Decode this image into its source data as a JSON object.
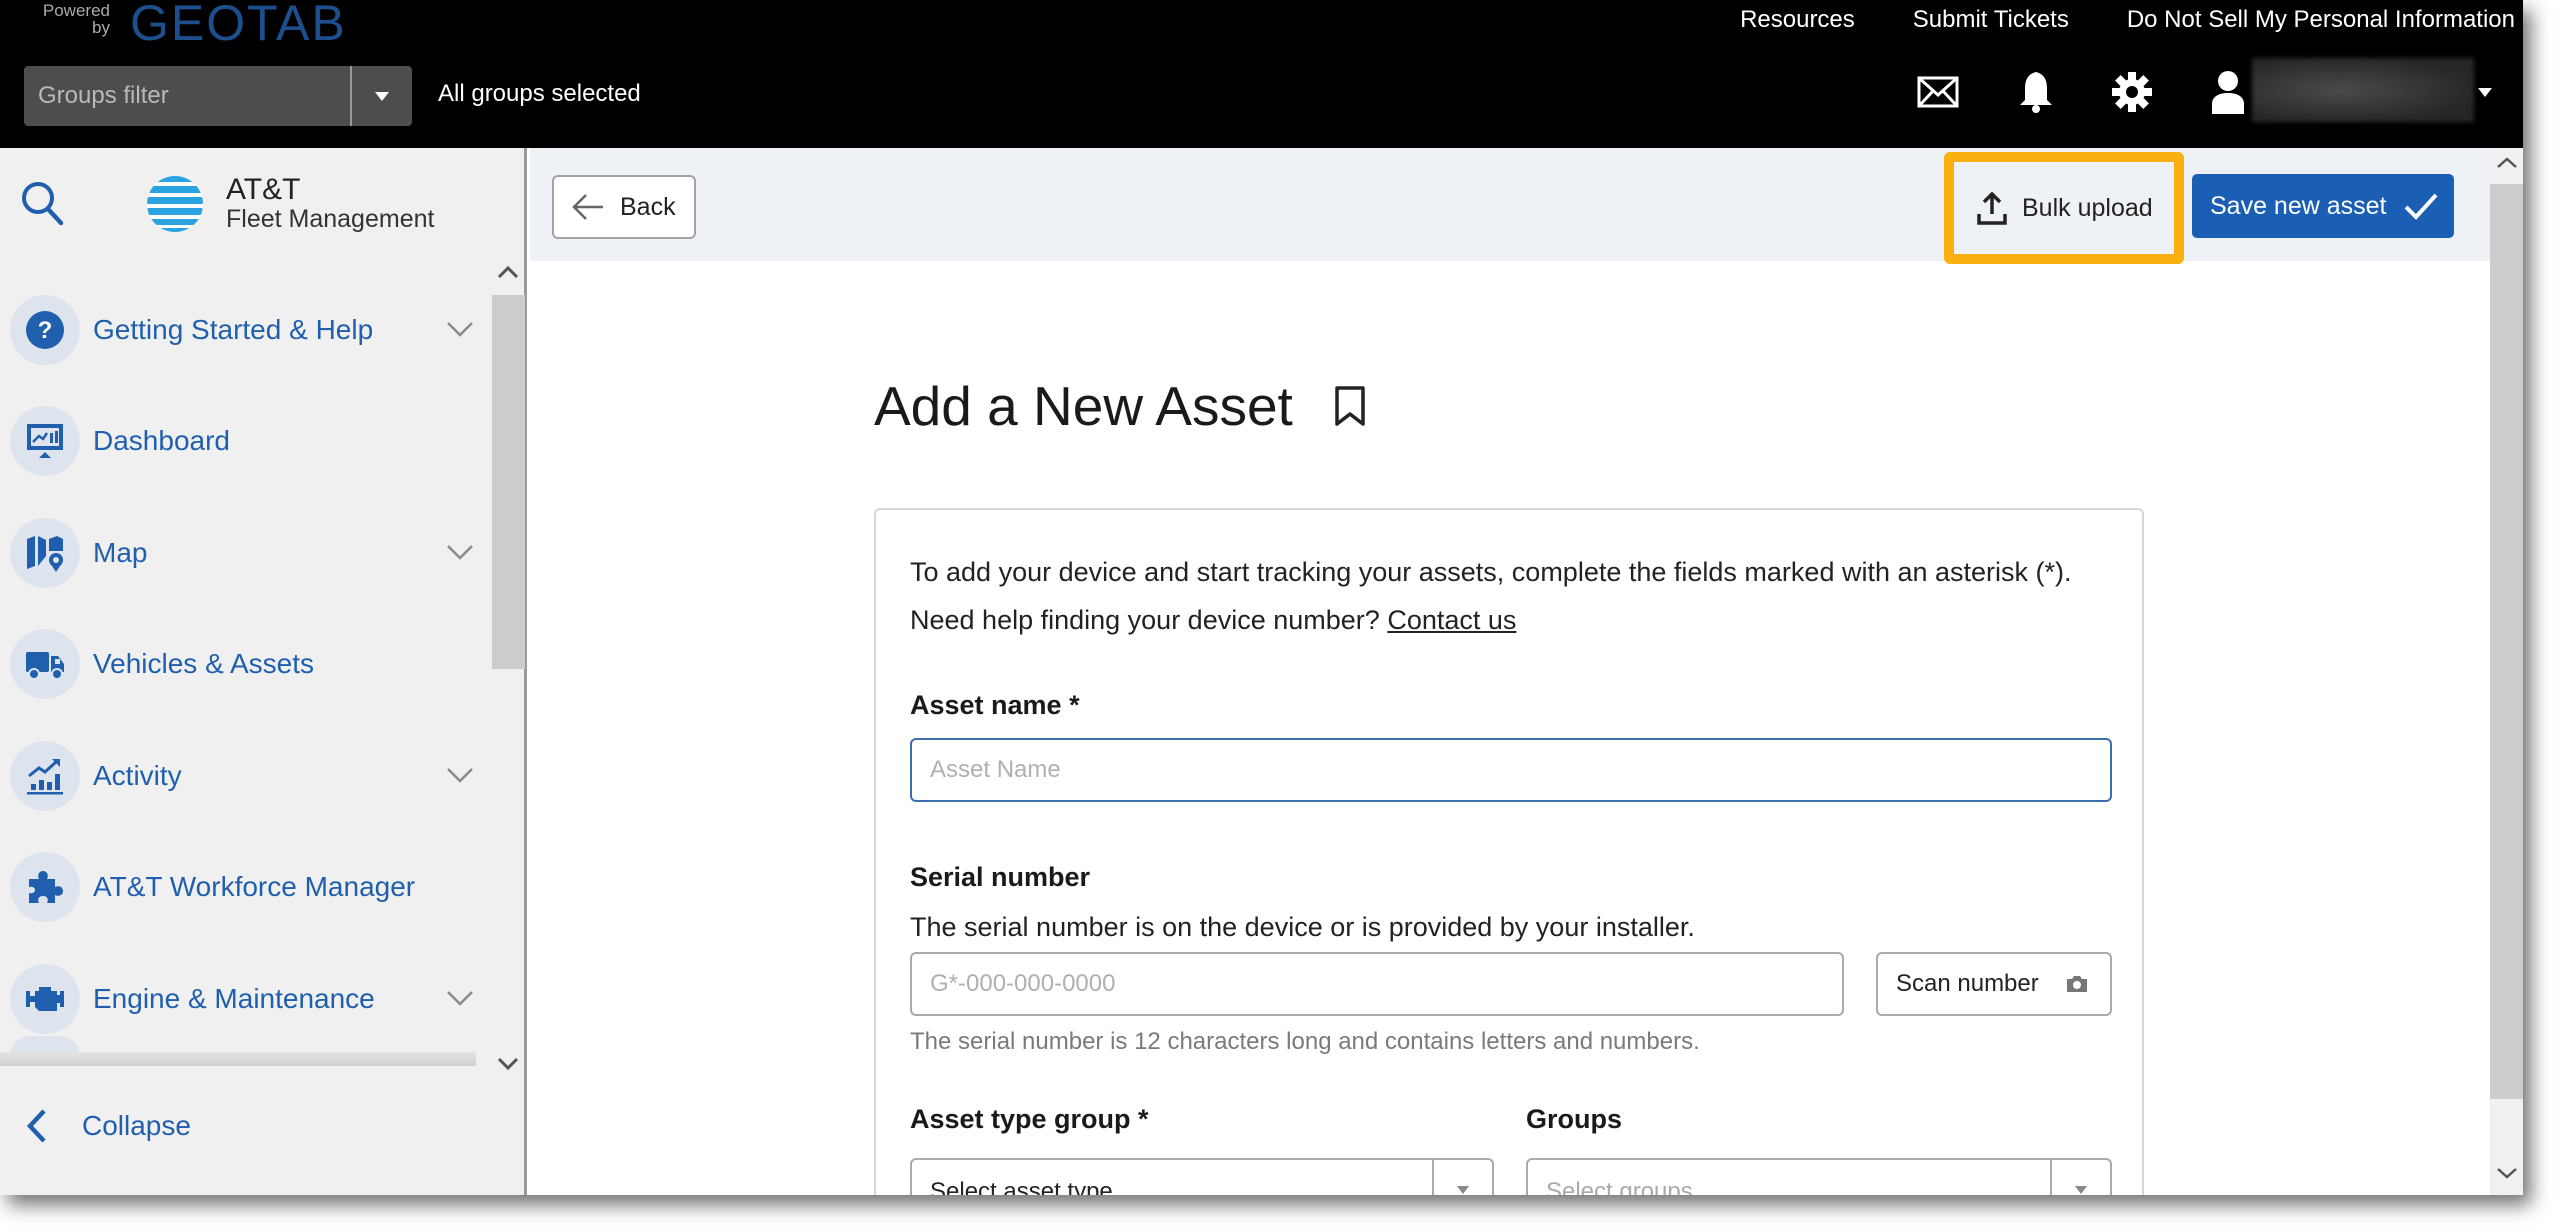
{
  "header": {
    "powered_by": "Powered by",
    "brand": "GEOTAB",
    "links": [
      "Resources",
      "Submit Tickets",
      "Do Not Sell My Personal Information"
    ],
    "groups_filter": {
      "placeholder": "Groups filter",
      "status": "All groups selected"
    },
    "icons": [
      "mail-icon",
      "bell-icon",
      "gear-icon",
      "user-icon"
    ]
  },
  "sidebar": {
    "logo": {
      "line1": "AT&T",
      "line2": "Fleet Management"
    },
    "items": [
      {
        "label": "Getting Started & Help",
        "icon": "help-icon",
        "expandable": true
      },
      {
        "label": "Dashboard",
        "icon": "dashboard-icon",
        "expandable": false
      },
      {
        "label": "Map",
        "icon": "map-icon",
        "expandable": true
      },
      {
        "label": "Vehicles & Assets",
        "icon": "truck-icon",
        "expandable": false
      },
      {
        "label": "Activity",
        "icon": "activity-icon",
        "expandable": true
      },
      {
        "label": "AT&T Workforce Manager",
        "icon": "puzzle-icon",
        "expandable": false
      },
      {
        "label": "Engine & Maintenance",
        "icon": "engine-icon",
        "expandable": true
      }
    ],
    "collapse_label": "Collapse"
  },
  "toolbar": {
    "back_label": "Back",
    "bulk_upload_label": "Bulk upload",
    "save_label": "Save new asset",
    "highlight_color": "#f8b10f",
    "primary_color": "#1a5fb4"
  },
  "form": {
    "title": "Add a New Asset",
    "intro_line1": "To add your device and start tracking your assets, complete the fields marked with an asterisk (*).",
    "intro_line2": "Need help finding your device number?",
    "contact_link": "Contact us",
    "asset_name": {
      "label": "Asset name *",
      "placeholder": "Asset Name",
      "value": ""
    },
    "serial_number": {
      "label": "Serial number",
      "help": "The serial number is on the device or is provided by your installer.",
      "placeholder": "G*-000-000-0000",
      "value": "",
      "scan_label": "Scan number",
      "hint": "The serial number is 12 characters long and contains letters and numbers."
    },
    "asset_type_group": {
      "label": "Asset type group *",
      "value": "Select asset type"
    },
    "groups": {
      "label": "Groups",
      "placeholder": "Select groups"
    }
  }
}
